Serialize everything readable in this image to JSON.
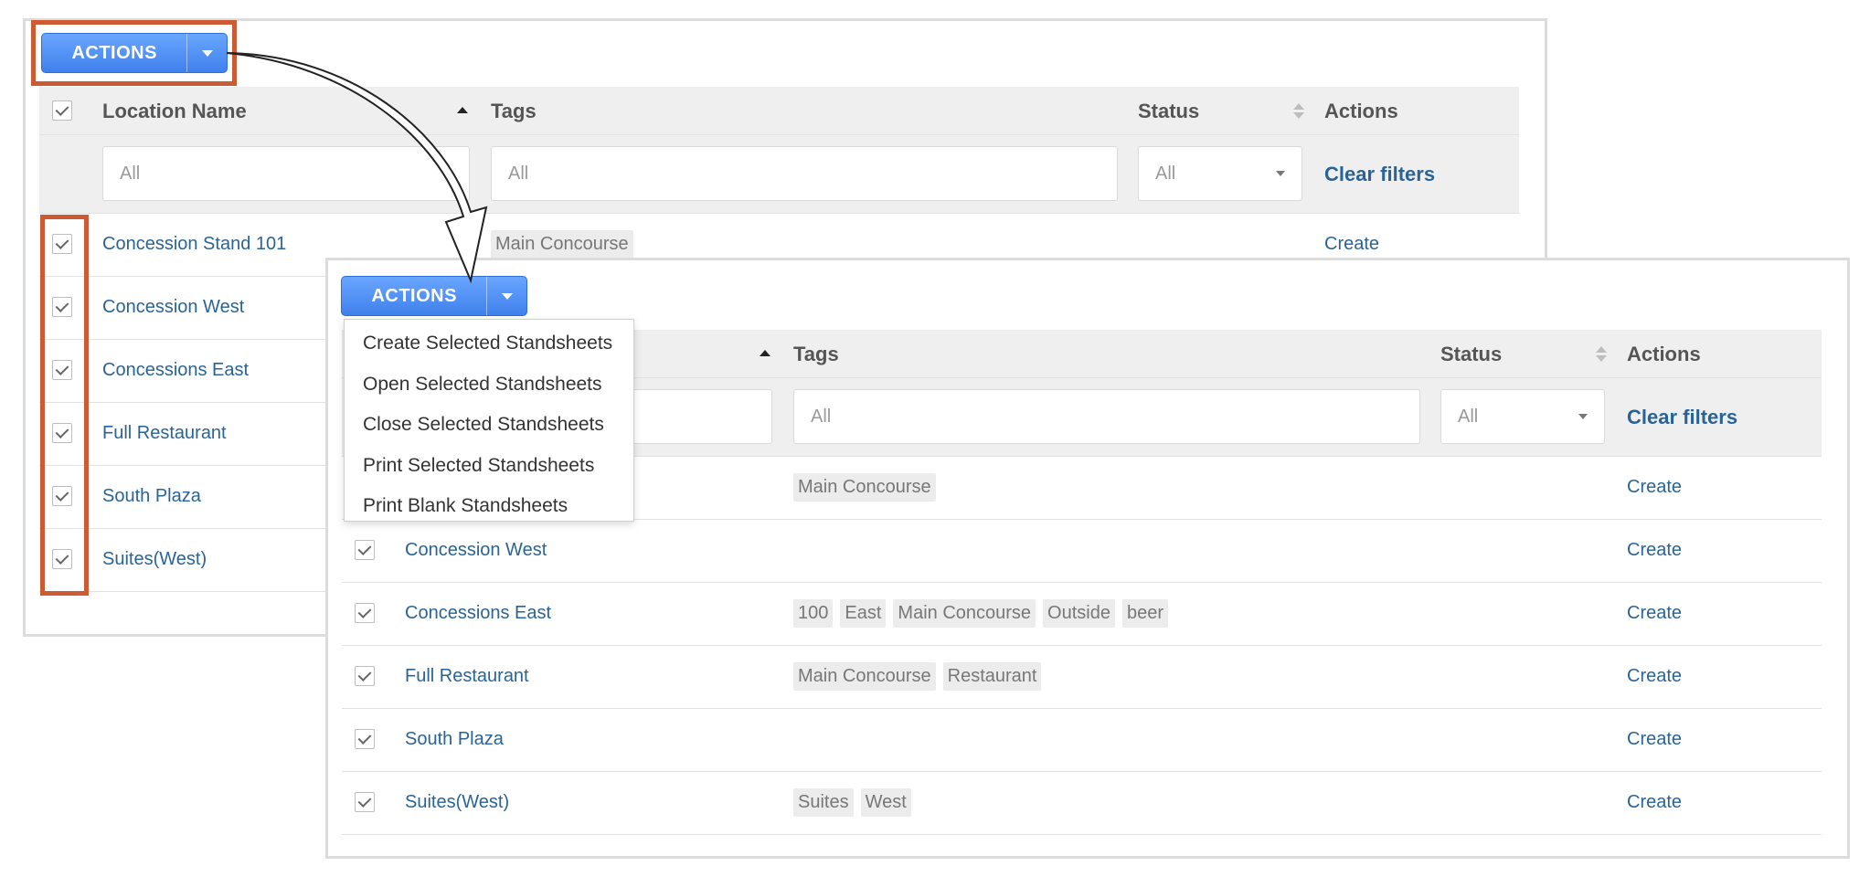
{
  "actions_button": {
    "label": "ACTIONS"
  },
  "columns": {
    "select": "",
    "location_name": "Location Name",
    "tags": "Tags",
    "status": "Status",
    "actions": "Actions"
  },
  "filters": {
    "location_placeholder": "All",
    "tags_placeholder": "All",
    "status_value": "All",
    "clear_label": "Clear filters"
  },
  "back_rows": [
    {
      "name": "Concession Stand 101",
      "tags": [
        "Main Concourse"
      ],
      "action": "Create"
    },
    {
      "name": "Concession West",
      "tags": [],
      "action": ""
    },
    {
      "name": "Concessions East",
      "tags": [],
      "action": ""
    },
    {
      "name": "Full Restaurant",
      "tags": [],
      "action": ""
    },
    {
      "name": "South Plaza",
      "tags": [],
      "action": ""
    },
    {
      "name": "Suites(West)",
      "tags": [],
      "action": ""
    }
  ],
  "front_rows": [
    {
      "name": "",
      "tags": [
        "Main Concourse"
      ],
      "action": "Create"
    },
    {
      "name": "Concession West",
      "tags": [],
      "action": "Create"
    },
    {
      "name": "Concessions East",
      "tags": [
        "100",
        "East",
        "Main Concourse",
        "Outside",
        "beer"
      ],
      "action": "Create"
    },
    {
      "name": "Full Restaurant",
      "tags": [
        "Main Concourse",
        "Restaurant"
      ],
      "action": "Create"
    },
    {
      "name": "South Plaza",
      "tags": [],
      "action": "Create"
    },
    {
      "name": "Suites(West)",
      "tags": [
        "Suites",
        "West"
      ],
      "action": "Create"
    }
  ],
  "dropdown_menu": [
    "Create Selected Standsheets",
    "Open Selected Standsheets",
    "Close Selected Standsheets",
    "Print Selected Standsheets",
    "Print Blank Standsheets"
  ],
  "colors": {
    "accent": "#4a8af4",
    "link": "#2a6496",
    "highlight": "#cc5a33",
    "header_bg": "#efefef",
    "tag_bg": "#ececec"
  }
}
